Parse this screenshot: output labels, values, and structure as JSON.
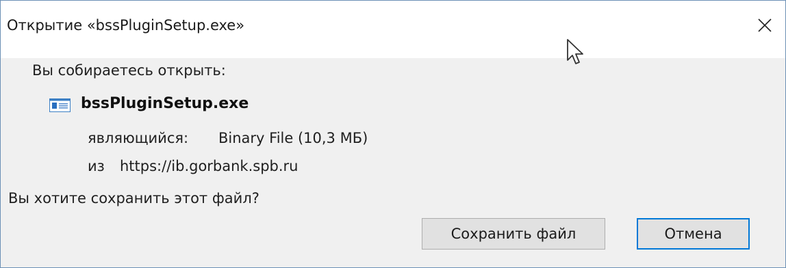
{
  "dialog": {
    "title": "Открытие «bssPluginSetup.exe»",
    "prompt": "Вы собираетесь открыть:",
    "file": {
      "name": "bssPluginSetup.exe",
      "icon": "executable-file-icon",
      "type_label": "являющийся:",
      "type_value": "Binary File (10,3 МБ)",
      "from_label": "из",
      "from_value": "https://ib.gorbank.spb.ru"
    },
    "question": "Вы хотите сохранить этот файл?",
    "buttons": {
      "save": "Сохранить файл",
      "cancel": "Отмена"
    }
  },
  "colors": {
    "window_border": "#6b8fb5",
    "dialog_background": "#f0f0f0",
    "focus_border": "#0078d7"
  }
}
